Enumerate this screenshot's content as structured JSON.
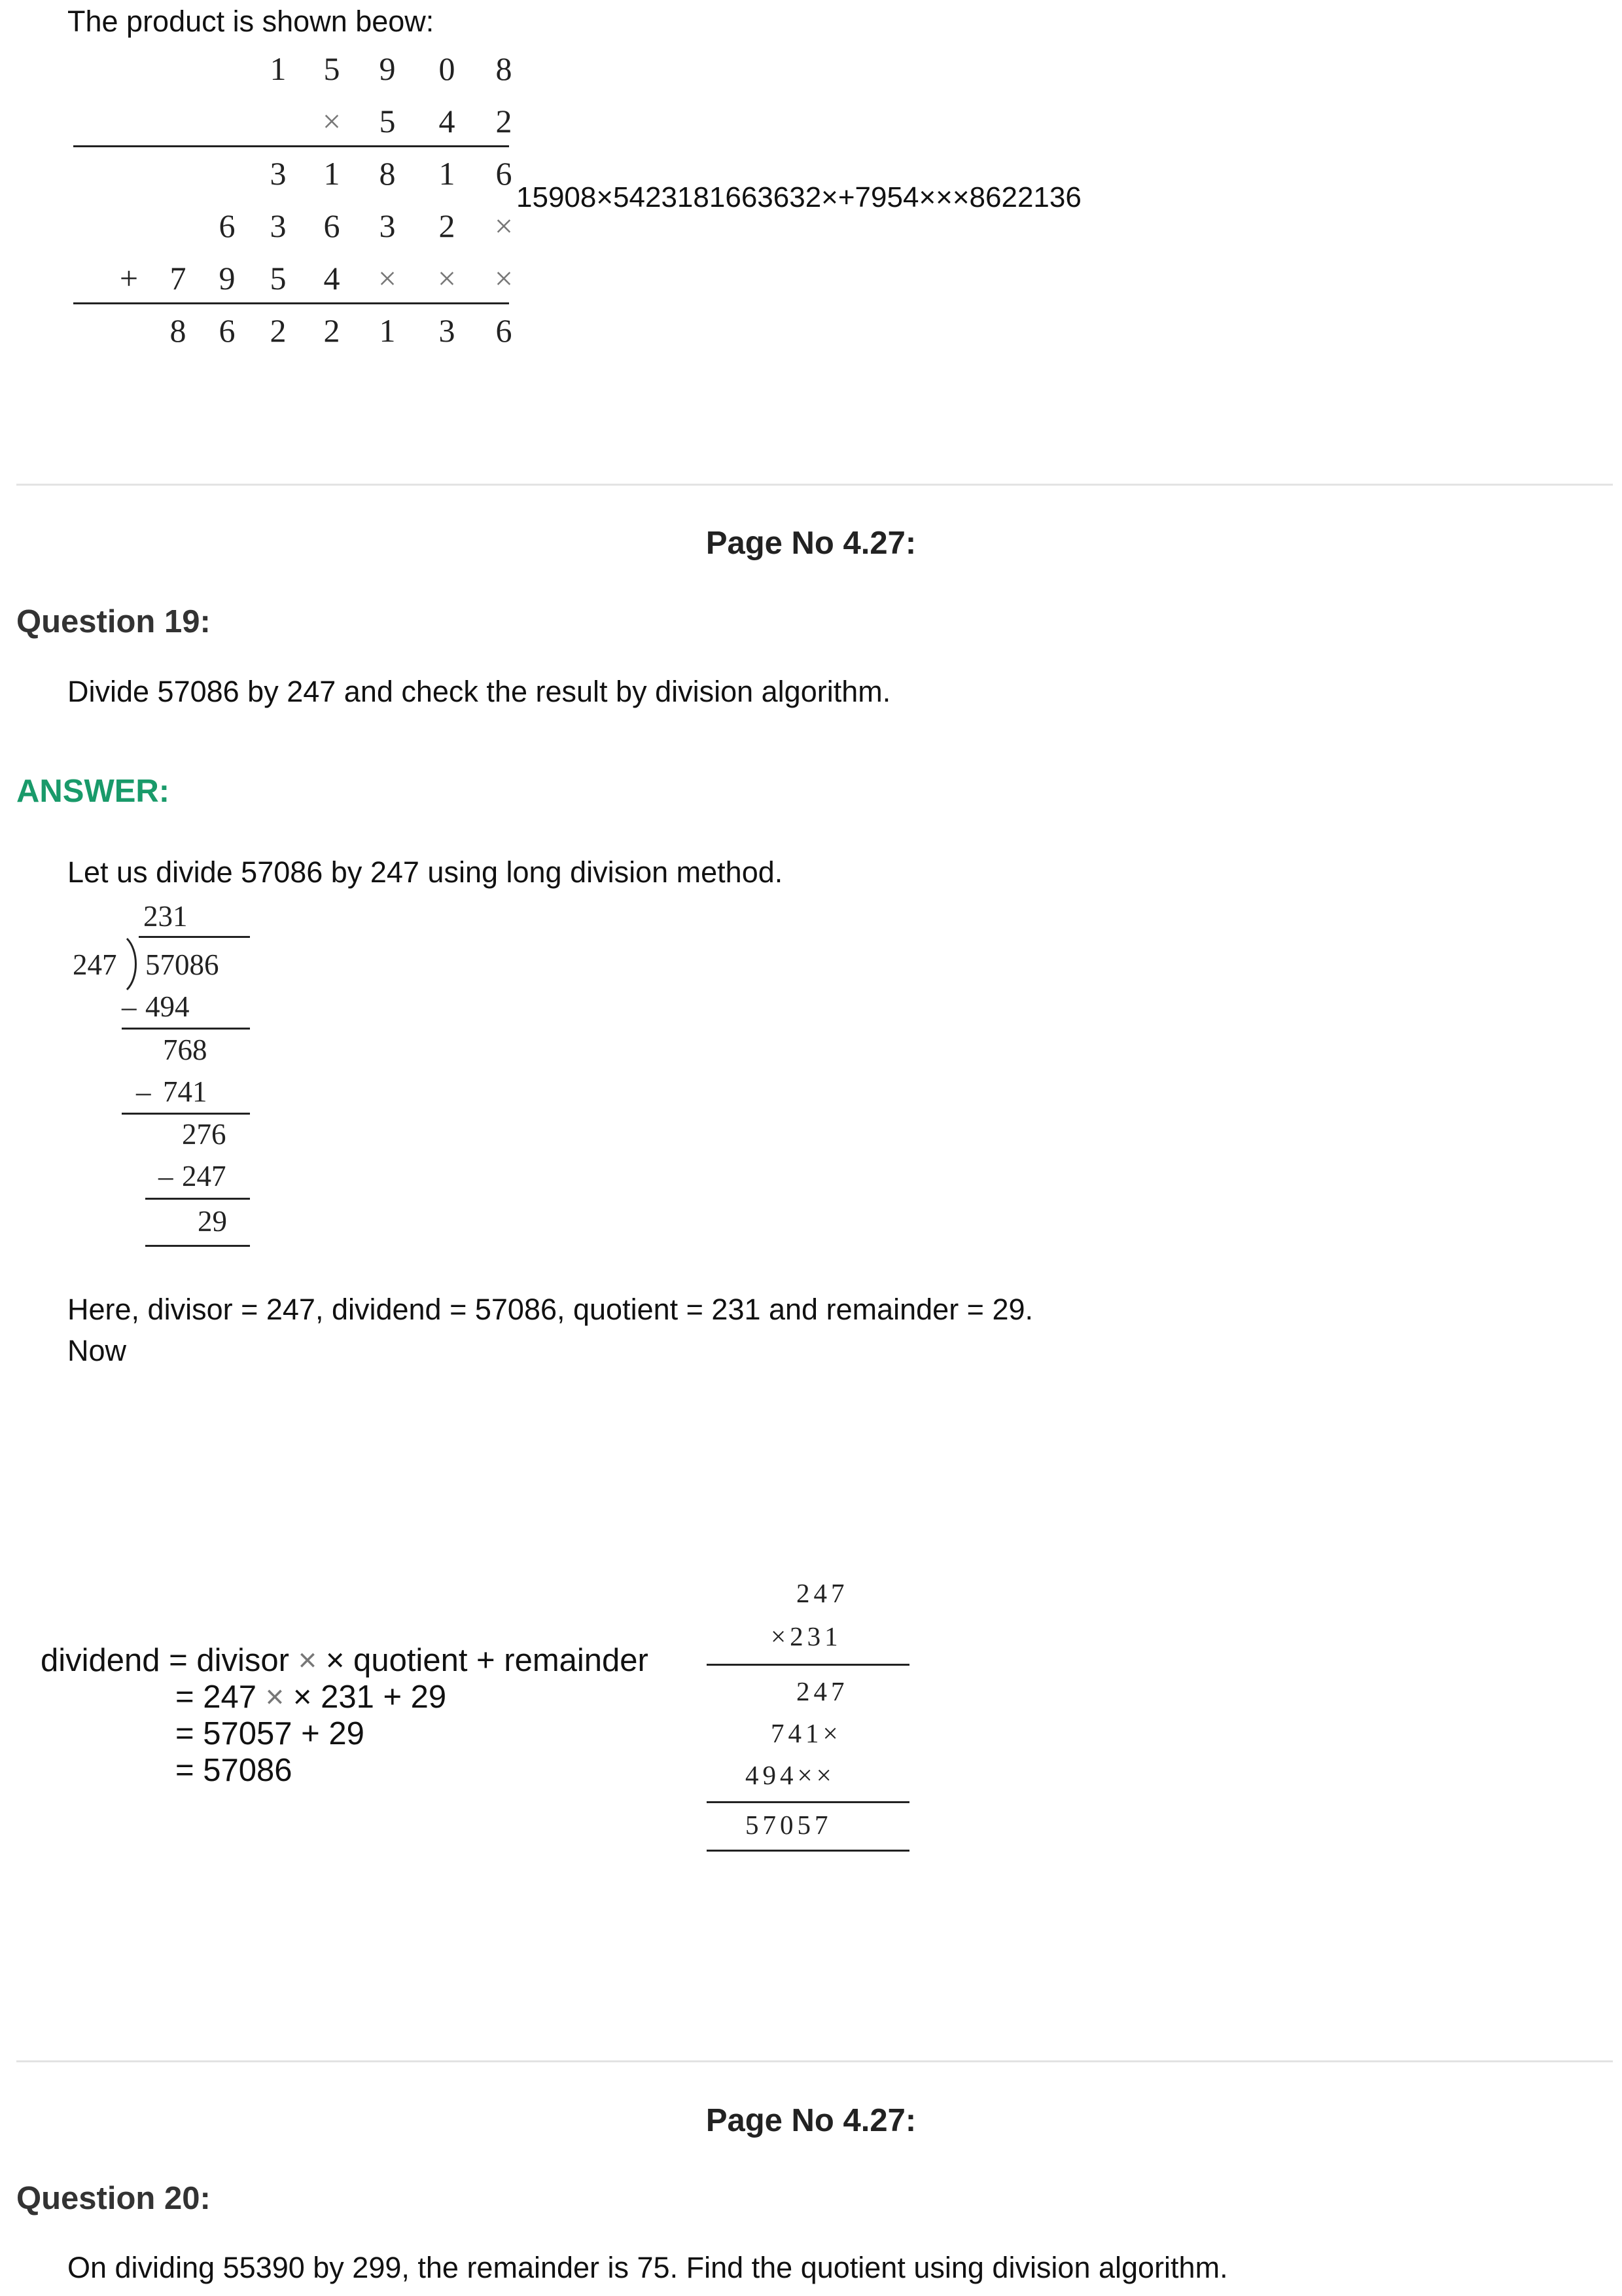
{
  "intro": "The product is shown beow:",
  "multiplication": {
    "rows": [
      [
        "",
        "",
        "",
        "1",
        "5",
        "9",
        "0",
        "8"
      ],
      [
        "",
        "",
        "",
        "",
        "",
        "×",
        "5",
        "4",
        "2"
      ],
      [
        "",
        "",
        "",
        "3",
        "1",
        "8",
        "1",
        "6"
      ],
      [
        "",
        "",
        "6",
        "3",
        "6",
        "3",
        "2",
        "×"
      ],
      [
        "+",
        "7",
        "9",
        "5",
        "4",
        "×",
        "×",
        "×"
      ],
      [
        "",
        "8",
        "6",
        "2",
        "2",
        "1",
        "3",
        "6"
      ]
    ],
    "inline_text": "15908×5423181663632×+7954×××8622136"
  },
  "sections": [
    {
      "page_label": "Page No 4.27:",
      "question_label": "Question 19:",
      "question_text": "Divide 57086 by 247 and check the result by division algorithm.",
      "answer_label": "ANSWER:",
      "answer_intro": "Let us divide 57086 by 247 using long division method.",
      "long_division": {
        "quotient": "231",
        "divisor": "247",
        "dividend": "57086",
        "steps": [
          "494",
          "768",
          "741",
          "276",
          "247",
          "29"
        ],
        "minus": "–"
      },
      "values_line": "Here, divisor = 247, dividend = 57086, quotient = 231 and remainder = 29.",
      "now": "Now",
      "verification": {
        "line1_a": "dividend = divisor ",
        "x_glyph": "×",
        "line1_b": " × quotient + remainder",
        "line2_a": "= 247 ",
        "line2_b": " × 231 + 29",
        "line3": "= 57057 + 29",
        "line4": "= 57086"
      },
      "check_multiplication": {
        "top": "247",
        "multiplier": "×231",
        "partials": [
          "247",
          "741×",
          "494××"
        ],
        "result": "57057"
      }
    },
    {
      "page_label": "Page No 4.27:",
      "question_label": "Question 20:",
      "question_text": "On dividing 55390 by 299, the remainder is 75. Find the quotient using division algorithm."
    }
  ]
}
